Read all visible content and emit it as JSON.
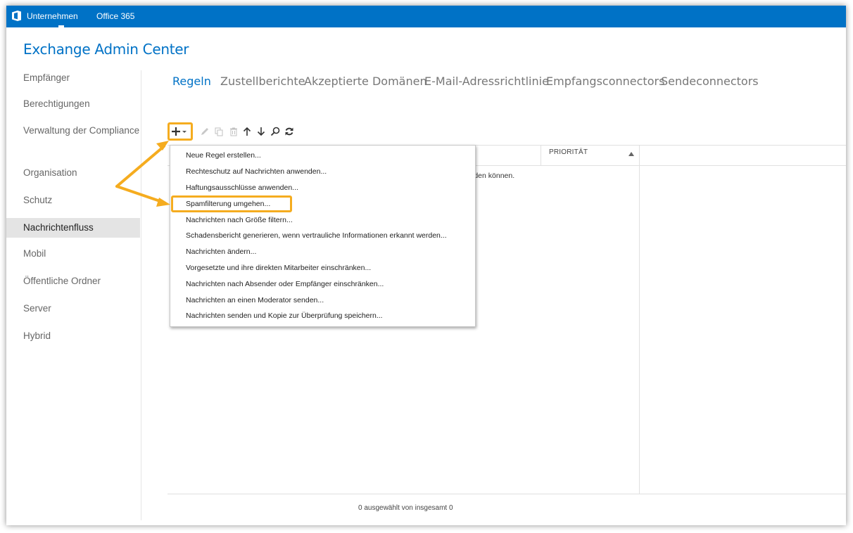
{
  "topbar": {
    "links": [
      "Unternehmen",
      "Office 365"
    ]
  },
  "app_title": "Exchange Admin Center",
  "sidebar": {
    "items": [
      {
        "label": "Empfänger"
      },
      {
        "label": "Berechtigungen"
      },
      {
        "label": "Verwaltung der Compliance"
      },
      {
        "label": "Organisation"
      },
      {
        "label": "Schutz"
      },
      {
        "label": "Nachrichtenfluss",
        "selected": true
      },
      {
        "label": "Mobil"
      },
      {
        "label": "Öffentliche Ordner"
      },
      {
        "label": "Server"
      },
      {
        "label": "Hybrid"
      }
    ]
  },
  "tabs": [
    {
      "label": "Regeln",
      "active": true
    },
    {
      "label": "Zustellberichte"
    },
    {
      "label": "Akzeptierte Domänen"
    },
    {
      "label": "E-Mail-Adressrichtlinie"
    },
    {
      "label": "Empfangsconnectors"
    },
    {
      "label": "Sendeconnectors"
    }
  ],
  "toolbar": {
    "icons": [
      "add-icon",
      "edit-icon",
      "copy-icon",
      "delete-icon",
      "move-up-icon",
      "move-down-icon",
      "search-icon",
      "refresh-icon"
    ]
  },
  "grid": {
    "columns": [
      "PRIORITÄT"
    ],
    "empty_message_partial": "erden können.",
    "status": "0 ausgewählt von insgesamt 0"
  },
  "dropdown": {
    "items": [
      "Neue Regel erstellen...",
      "Rechteschutz auf Nachrichten anwenden...",
      "Haftungsausschlüsse anwenden...",
      "Spamfilterung umgehen...",
      "Nachrichten nach Größe filtern...",
      "Schadensbericht generieren, wenn vertrauliche Informationen erkannt werden...",
      "Nachrichten ändern...",
      "Vorgesetzte und ihre direkten Mitarbeiter einschränken...",
      "Nachrichten nach Absender oder Empfänger einschränken...",
      "Nachrichten an einen Moderator senden...",
      "Nachrichten senden und Kopie zur Überprüfung speichern..."
    ],
    "highlighted_item": "Spamfilterung umgehen..."
  },
  "colors": {
    "brand_blue": "#0072c6",
    "annotation_orange": "#f5ac1f",
    "selected_nav_bg": "#e4e4e4"
  }
}
